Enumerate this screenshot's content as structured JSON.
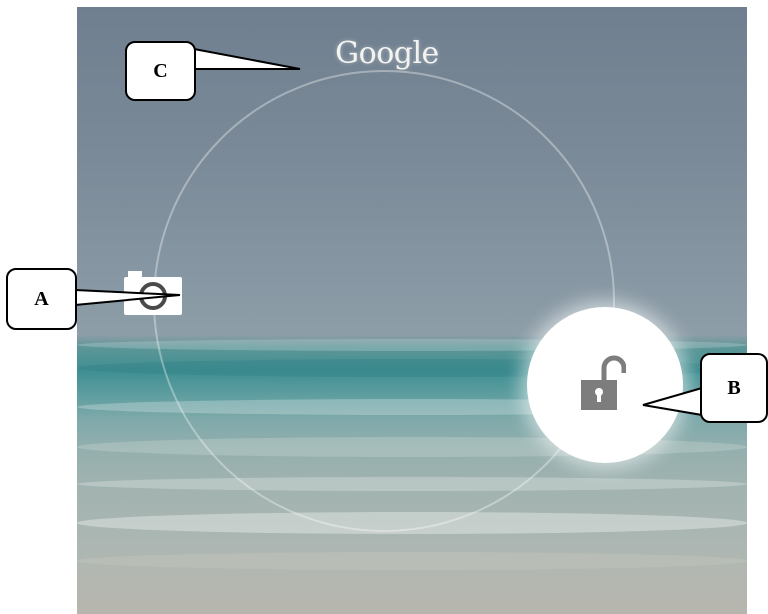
{
  "lockscreen": {
    "google_label": "Google",
    "camera_icon": "camera-icon",
    "unlock_icon": "unlock-icon"
  },
  "callouts": {
    "c_label": "C",
    "a_label": "A",
    "b_label": "B"
  },
  "colors": {
    "sky": "#7b8a98",
    "sea": "#3f8f92",
    "sand": "#b2b7b1",
    "handle": "#ffffff",
    "lock_glyph": "#7d7d7d"
  }
}
